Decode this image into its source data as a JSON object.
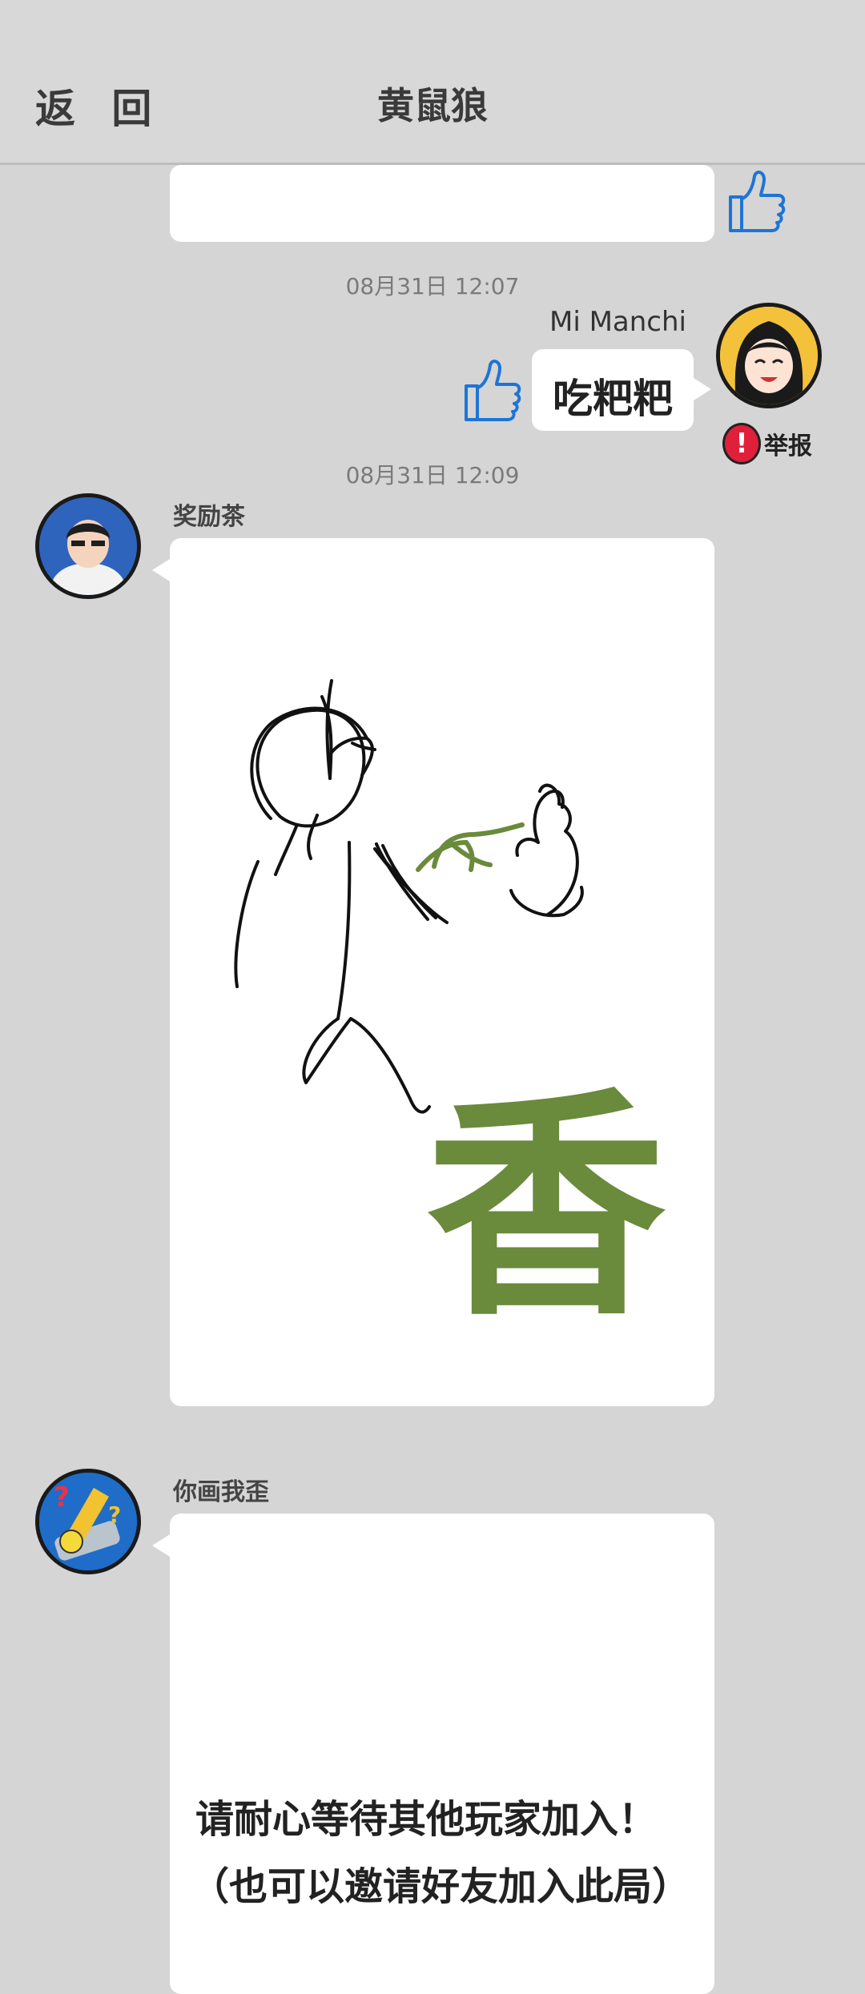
{
  "header": {
    "back_label": "返 回",
    "title": "黄鼠狼"
  },
  "messages": {
    "t1": "08月31日  12:07",
    "self_name": "Mi Manchi",
    "self_text": "吃粑粑",
    "report_label": "举报",
    "t2": "08月31日  12:09",
    "drawer_name": "奖励茶",
    "drawing_char": "香",
    "bot_name": "你画我歪",
    "wait_line1": "请耐心等待其他玩家加入！",
    "wait_line2": "（也可以邀请好友加入此局）"
  },
  "colors": {
    "background": "#d5d5d5",
    "like_blue": "#1e74d6",
    "report_red": "#e0203a",
    "drawing_green": "#6a8a3c"
  }
}
